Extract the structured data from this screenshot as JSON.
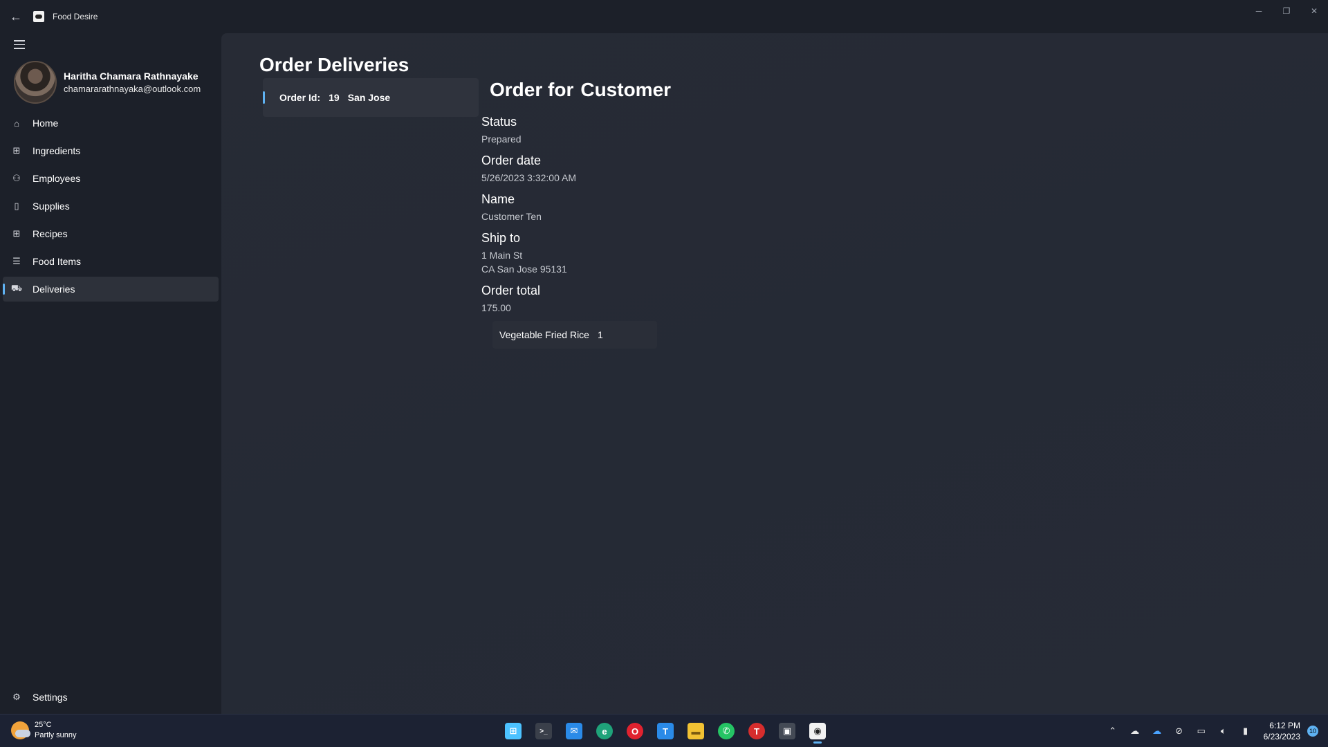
{
  "window": {
    "title": "Food Desire",
    "controls": {
      "minimize": "─",
      "restore": "❐",
      "close": "✕"
    }
  },
  "user": {
    "name": "Haritha Chamara Rathnayake",
    "email": "chamararathnayaka@outlook.com"
  },
  "nav": {
    "items": [
      {
        "label": "Home",
        "icon": "home-icon",
        "glyph": "⌂"
      },
      {
        "label": "Ingredients",
        "icon": "ingredients-icon",
        "glyph": "⊞"
      },
      {
        "label": "Employees",
        "icon": "employees-icon",
        "glyph": "⚇"
      },
      {
        "label": "Supplies",
        "icon": "supplies-icon",
        "glyph": "▯"
      },
      {
        "label": "Recipes",
        "icon": "recipes-icon",
        "glyph": "⊞"
      },
      {
        "label": "Food Items",
        "icon": "food-items-icon",
        "glyph": "☰"
      },
      {
        "label": "Deliveries",
        "icon": "deliveries-icon",
        "glyph": "⛟",
        "active": true
      }
    ],
    "settings": {
      "label": "Settings",
      "icon": "gear-icon",
      "glyph": "⚙"
    }
  },
  "page": {
    "title": "Order Deliveries",
    "orders": [
      {
        "id_label": "Order Id:",
        "id": "19",
        "city": "San Jose"
      }
    ]
  },
  "detail": {
    "title_prefix": "Order for",
    "title_name": "Customer",
    "status_label": "Status",
    "status": "Prepared",
    "order_date_label": "Order date",
    "order_date": "5/26/2023 3:32:00 AM",
    "name_label": "Name",
    "name": "Customer Ten",
    "ship_to_label": "Ship to",
    "ship_to_line1": "1 Main St",
    "ship_to_line2": "CA San Jose 95131",
    "total_label": "Order total",
    "total": "175.00",
    "line_items": [
      {
        "name": "Vegetable Fried Rice",
        "qty": "1"
      }
    ]
  },
  "taskbar": {
    "weather_temp": "25°C",
    "weather_desc": "Partly sunny",
    "time": "6:12 PM",
    "date": "6/23/2023",
    "notification_count": "10",
    "apps": [
      {
        "name": "start-icon",
        "glyph": "⊞",
        "color": "#4cc2ff"
      },
      {
        "name": "terminal-icon",
        "glyph": ">_",
        "color": "#3a3f4a"
      },
      {
        "name": "mail-icon",
        "glyph": "✉",
        "color": "#2a8ae8"
      },
      {
        "name": "edge-dev-icon",
        "glyph": "e",
        "color": "#1fa37a"
      },
      {
        "name": "opera-icon",
        "glyph": "O",
        "color": "#e0222f"
      },
      {
        "name": "teams-icon",
        "glyph": "T",
        "color": "#2a8ae8"
      },
      {
        "name": "file-explorer-icon",
        "glyph": "▬",
        "color": "#f2c233"
      },
      {
        "name": "whatsapp-icon",
        "glyph": "✆",
        "color": "#25c464"
      },
      {
        "name": "t-app-icon",
        "glyph": "T",
        "color": "#d62d2d"
      },
      {
        "name": "package-icon",
        "glyph": "▣",
        "color": "#444a55"
      },
      {
        "name": "food-desire-icon",
        "glyph": "◉",
        "color": "#f2f2f2",
        "active": true
      }
    ]
  },
  "colors": {
    "accent": "#5fb2f2",
    "background": "#1c2029",
    "content_background": "#262a34"
  }
}
